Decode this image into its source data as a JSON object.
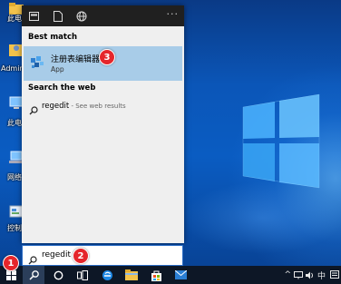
{
  "desktop": {
    "icons": [
      {
        "label": "此电脑",
        "icon": "folder-icon"
      },
      {
        "label": "Admini",
        "icon": "user-folder-icon"
      },
      {
        "label": "此电",
        "icon": "computer-icon"
      },
      {
        "label": "网络",
        "icon": "network-icon"
      },
      {
        "label": "控制",
        "icon": "control-panel-icon"
      }
    ]
  },
  "start": {
    "topbar_more": "···",
    "best_match_heading": "Best match",
    "best_match": {
      "title": "注册表编辑器",
      "subtitle": "App",
      "icon": "registry-editor-icon"
    },
    "web_heading": "Search the web",
    "web_result": {
      "query": "regedit",
      "suffix": " - See web results"
    }
  },
  "search": {
    "value": "regedit"
  },
  "badges": {
    "one": "1",
    "two": "2",
    "three": "3"
  },
  "colors": {
    "badge": "#e5262b",
    "selected_row": "#a8cce8",
    "taskbar": "#0d1726"
  }
}
